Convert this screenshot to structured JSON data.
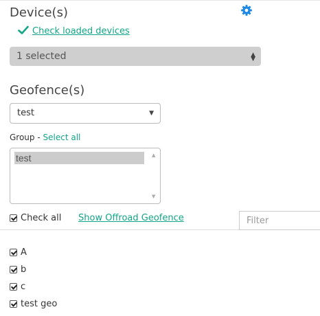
{
  "devices": {
    "title": "Device(s)",
    "check_loaded_link": "Check loaded devices",
    "selected_value": "1 selected"
  },
  "geofences": {
    "title": "Geofence(s)",
    "select_value": "test",
    "group_label": "Group - ",
    "select_all_link": "Select all",
    "group_list": [
      "test"
    ]
  },
  "controls": {
    "check_all_label": "Check all",
    "offroad_link": "Show Offroad Geofence",
    "filter_placeholder": "Filter"
  },
  "geofence_items": [
    {
      "label": "A",
      "checked": true
    },
    {
      "label": "b",
      "checked": true
    },
    {
      "label": "c",
      "checked": true
    },
    {
      "label": "test geo",
      "checked": true
    }
  ],
  "colors": {
    "accent": "#12a587",
    "gear": "#1e88e5"
  },
  "icons": {
    "settings": "gear-icon",
    "loaded": "checkmark-icon"
  }
}
